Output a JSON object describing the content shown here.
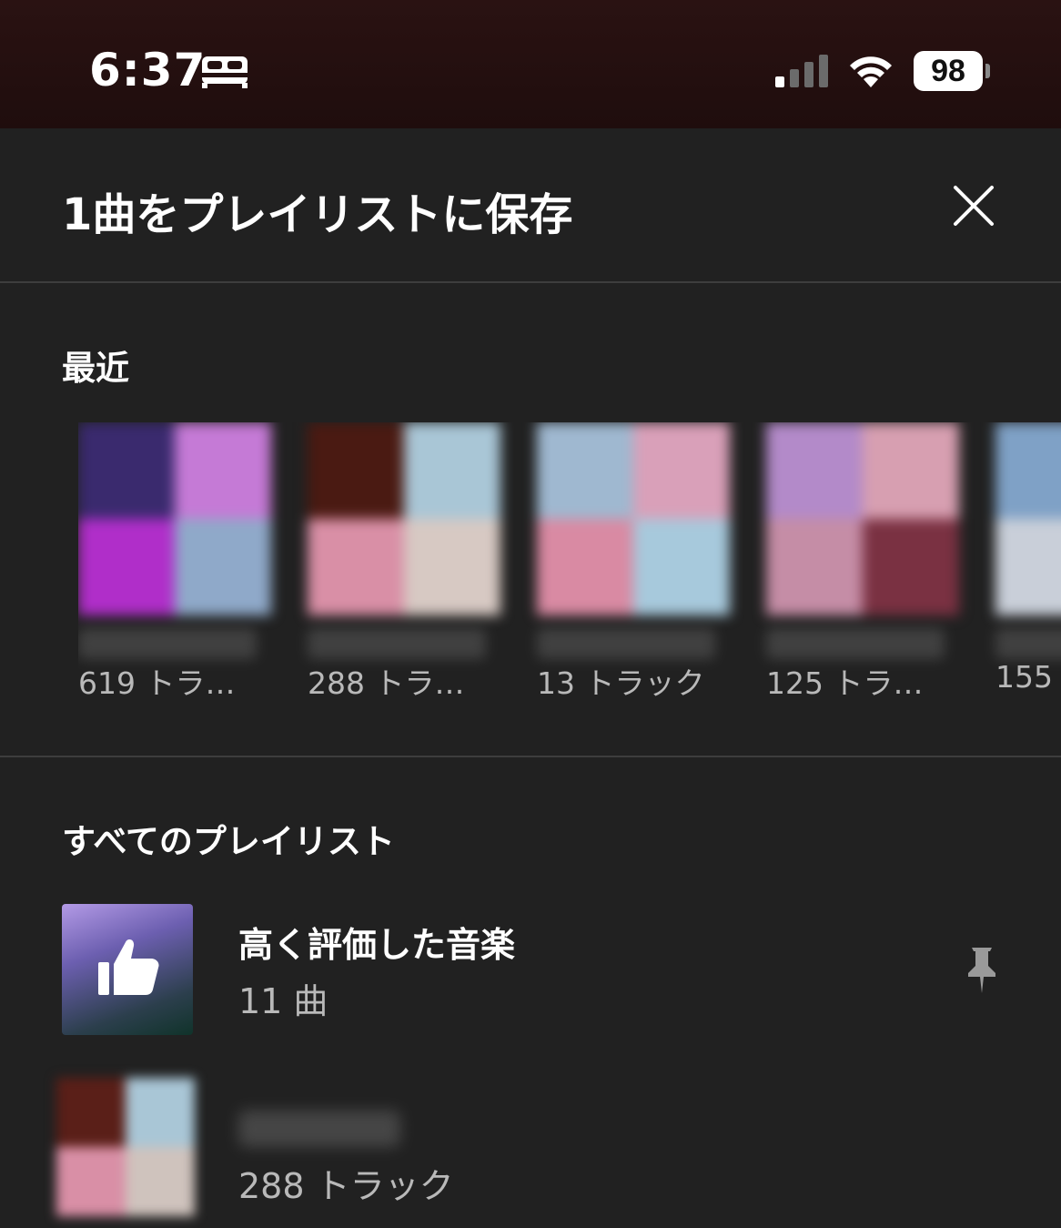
{
  "status_bar": {
    "time": "6:37",
    "battery": "98",
    "icons": [
      "bed-icon",
      "cellular-signal-icon",
      "wifi-icon",
      "battery-icon"
    ]
  },
  "header": {
    "title": "1曲をプレイリストに保存",
    "close_icon": "close-icon"
  },
  "recent": {
    "title": "最近",
    "items": [
      {
        "count": "619 トラ…",
        "colors": [
          "#3a2a6e",
          "#c57ad6",
          "#b02ec9",
          "#8fa9c9"
        ]
      },
      {
        "count": "288 トラ…",
        "colors": [
          "#4a1a12",
          "#a9c6d6",
          "#d98fa6",
          "#d7c9c3"
        ]
      },
      {
        "count": "13 トラック",
        "colors": [
          "#9fb8d0",
          "#d9a0b9",
          "#d98aa3",
          "#a7c9dc"
        ]
      },
      {
        "count": "125 トラ…",
        "colors": [
          "#b38ac9",
          "#d79fb1",
          "#c58da6",
          "#7a3142"
        ]
      },
      {
        "count": "155",
        "colors": [
          "#7fa1c6",
          "#9bb4cc",
          "#c9cfd9",
          "#a9b9c9"
        ]
      }
    ]
  },
  "all_playlists": {
    "title": "すべてのプレイリスト",
    "items": [
      {
        "title": "高く評価した音楽",
        "subtitle": "11 曲",
        "icon": "thumb-up-icon",
        "pinned": true
      },
      {
        "title": "",
        "subtitle": "288 トラック",
        "colors": [
          "#5a1f18",
          "#a9c6d6",
          "#d98fa6",
          "#cfc3bd"
        ]
      }
    ]
  },
  "colors": {
    "background": "#212121",
    "divider": "#3d3d3d",
    "secondary_text": "#b9b9b9"
  }
}
